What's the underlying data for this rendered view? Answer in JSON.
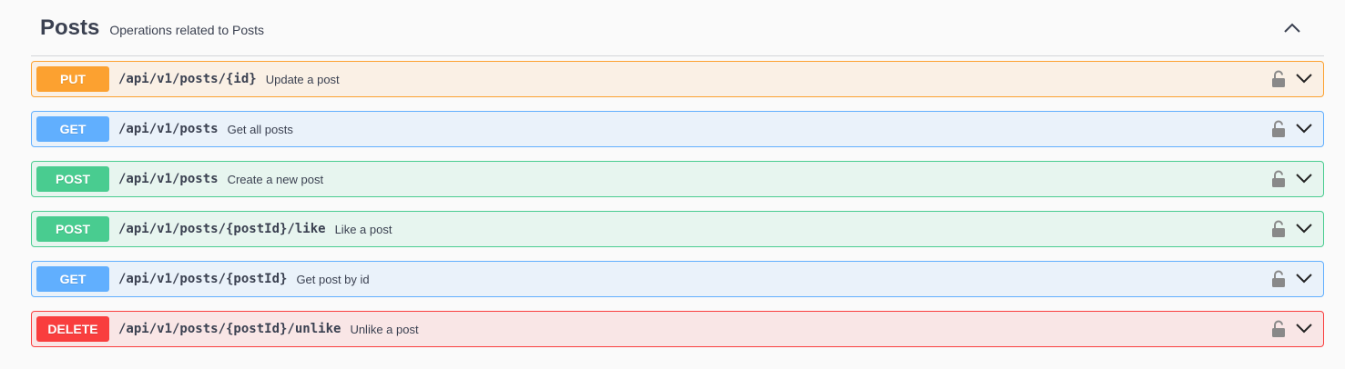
{
  "tag": {
    "title": "Posts",
    "description": "Operations related to Posts"
  },
  "operations": [
    {
      "method": "PUT",
      "path": "/api/v1/posts/{id}",
      "summary": "Update a post"
    },
    {
      "method": "GET",
      "path": "/api/v1/posts",
      "summary": "Get all posts"
    },
    {
      "method": "POST",
      "path": "/api/v1/posts",
      "summary": "Create a new post"
    },
    {
      "method": "POST",
      "path": "/api/v1/posts/{postId}/like",
      "summary": "Like a post"
    },
    {
      "method": "GET",
      "path": "/api/v1/posts/{postId}",
      "summary": "Get post by id"
    },
    {
      "method": "DELETE",
      "path": "/api/v1/posts/{postId}/unlike",
      "summary": "Unlike a post"
    }
  ],
  "colors": {
    "put": "#fca130",
    "get": "#61affe",
    "post": "#49cc90",
    "delete": "#f93e3e"
  },
  "icons": {
    "collapse": "chevron-up-icon",
    "expand": "chevron-down-icon",
    "auth": "unlocked-icon"
  }
}
